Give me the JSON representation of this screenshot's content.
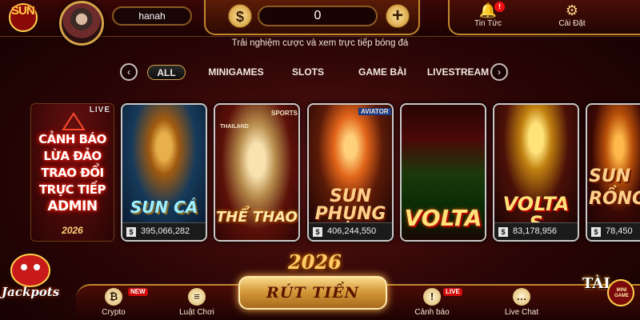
{
  "header": {
    "logo_text": "SUN",
    "username": "hanah",
    "balance": "0",
    "currency_symbol": "$",
    "add_symbol": "+",
    "marquee": "Trải nghiệm cược và xem trực tiếp bóng đá",
    "news_label": "Tin Tức",
    "news_badge": "!",
    "settings_label": "Cài Đặt"
  },
  "tabs": {
    "items": [
      {
        "label": "ALL",
        "active": true
      },
      {
        "label": "MINIGAMES"
      },
      {
        "label": "SLOTS"
      },
      {
        "label": "GAME BÀI"
      },
      {
        "label": "LIVESTREAM"
      }
    ],
    "prev_arrow": "‹",
    "next_arrow": "›"
  },
  "live_card": {
    "tag": "LIVE",
    "lines": [
      "CẢNH BÁO",
      "LỪA ĐẢO",
      "TRAO ĐỔI",
      "TRỰC TIẾP",
      "ADMIN"
    ],
    "year": "2026"
  },
  "cards": [
    {
      "title": "SUN CÁ",
      "jackpot": "395,066,282"
    },
    {
      "title": "THỂ THAO",
      "sponsor": "THAILAND",
      "sponsor2": "SPORTS"
    },
    {
      "title": "SUN PHỤNG",
      "jackpot": "406,244,550",
      "sponsor": "AVIATOR"
    },
    {
      "title": "VOLTA"
    },
    {
      "title": "VOLTA S",
      "jackpot": "83,178,956"
    },
    {
      "title": "SUN RỒNG",
      "jackpot": "78,450"
    }
  ],
  "jackpot_currency": "$",
  "bottom": {
    "crypto_label": "Crypto",
    "crypto_badge": "NEW",
    "rules_label": "Luật Chơi",
    "withdraw_label": "RÚT TIỀN",
    "warning_label": "Cảnh báo",
    "warning_badge": "LIVE",
    "livechat_label": "Live Chat",
    "jackpots_label": "Jackpots",
    "minigame_label": "TÀI",
    "minigame_sub": "MINI GAME"
  },
  "decor_year": "2026",
  "colors": {
    "background": "#2a0505",
    "gold": "#c08830",
    "accent_red": "#d10a0a"
  }
}
